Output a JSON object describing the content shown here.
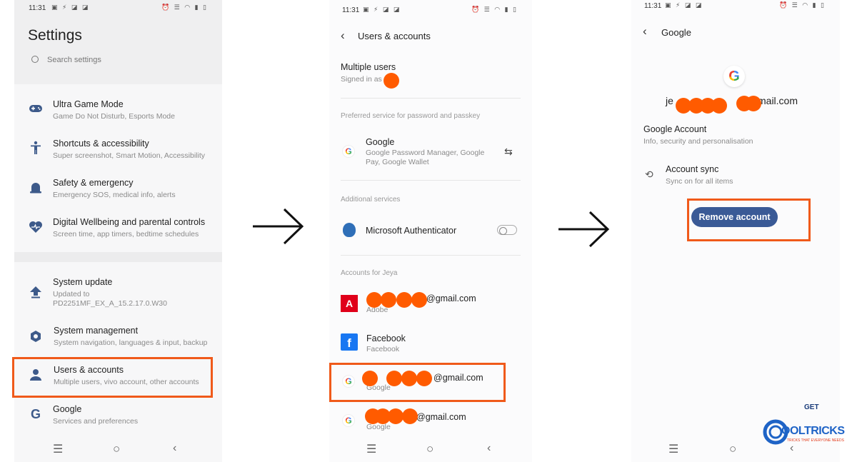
{
  "status": {
    "time": "11:31"
  },
  "settings": {
    "title": "Settings",
    "search_placeholder": "Search settings",
    "items": [
      {
        "label": "Ultra Game Mode",
        "sub": "Game Do Not Disturb, Esports Mode",
        "icon": "gamepad-icon"
      },
      {
        "label": "Shortcuts & accessibility",
        "sub": "Super screenshot, Smart Motion, Accessibility",
        "icon": "accessibility-icon"
      },
      {
        "label": "Safety & emergency",
        "sub": "Emergency SOS, medical info, alerts",
        "icon": "siren-icon"
      },
      {
        "label": "Digital Wellbeing and parental controls",
        "sub": "Screen time, app timers, bedtime schedules",
        "icon": "heart-icon"
      },
      {
        "label": "System update",
        "sub": "Updated to",
        "sub2": "PD2251MF_EX_A_15.2.17.0.W30",
        "icon": "update-arrow-icon"
      },
      {
        "label": "System management",
        "sub": "System navigation, languages & input, backup",
        "icon": "cog-icon"
      },
      {
        "label": "Users & accounts",
        "sub": "Multiple users, vivo account, other accounts",
        "icon": "user-icon"
      },
      {
        "label": "Google",
        "sub": "Services and preferences",
        "icon": "google-icon"
      }
    ]
  },
  "users_accounts": {
    "title": "Users & accounts",
    "multiple_users": {
      "label": "Multiple users",
      "sub": "Signed in as"
    },
    "preferred_header": "Preferred service for password and passkey",
    "preferred": {
      "label": "Google",
      "sub1": "Google Password Manager, Google",
      "sub2": "Pay, Google Wallet"
    },
    "additional_header": "Additional services",
    "authenticator": "Microsoft Authenticator",
    "accounts_header": "Accounts for Jeya",
    "accounts": [
      {
        "email": "@gmail.com",
        "type": "Adobe"
      },
      {
        "email": "Facebook",
        "type": "Facebook"
      },
      {
        "email": "@gmail.com",
        "type": "Google"
      },
      {
        "email": "@gmail.com",
        "type": "Google"
      }
    ]
  },
  "google": {
    "title": "Google",
    "email_prefix": "je",
    "email_suffix": "mail.com",
    "account_label": "Google Account",
    "account_sub": "Info, security and personalisation",
    "sync_label": "Account sync",
    "sync_sub": "Sync on for all items",
    "remove_button": "Remove account"
  },
  "logo": {
    "line1": "GET",
    "line2": "OOLTRICKS",
    "tagline": "TRICKS THAT EVERYONE NEEDS"
  },
  "colors": {
    "highlight": "#f05a1a",
    "blur": "#ff5b00",
    "button": "#3a5a96",
    "accent_icon": "#3d5a8a"
  }
}
